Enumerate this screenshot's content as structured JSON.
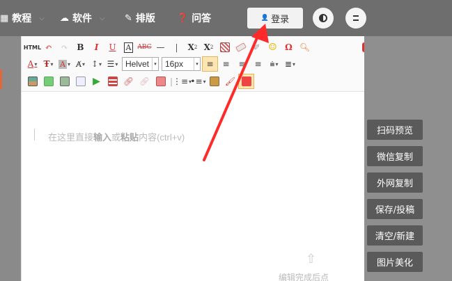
{
  "nav": {
    "tutorial": "教程",
    "software": "软件",
    "layout": "排版",
    "qa": "问答",
    "login": "登录"
  },
  "toolbar": {
    "html": "HTML",
    "bold": "B",
    "italic": "I",
    "underline": "U",
    "font_border": "A",
    "strike": "ABC",
    "font_family": "Helvet",
    "font_size": "16px",
    "omega": "Ω"
  },
  "editor": {
    "placeholder_pre": "在这里直接",
    "placeholder_input": "输入",
    "placeholder_mid": "或",
    "placeholder_paste": "粘贴",
    "placeholder_post": "内容(ctrl+v)",
    "bottom_hint": "编辑完成后点"
  },
  "sidebar": {
    "buttons": [
      "扫码预览",
      "微信复制",
      "外网复制",
      "保存/投稿",
      "清空/新建",
      "图片美化"
    ]
  },
  "colors": {
    "topbar": "#6e6e6e",
    "side_button": "#5a5a5a",
    "arrow": "#ff2a2a"
  }
}
